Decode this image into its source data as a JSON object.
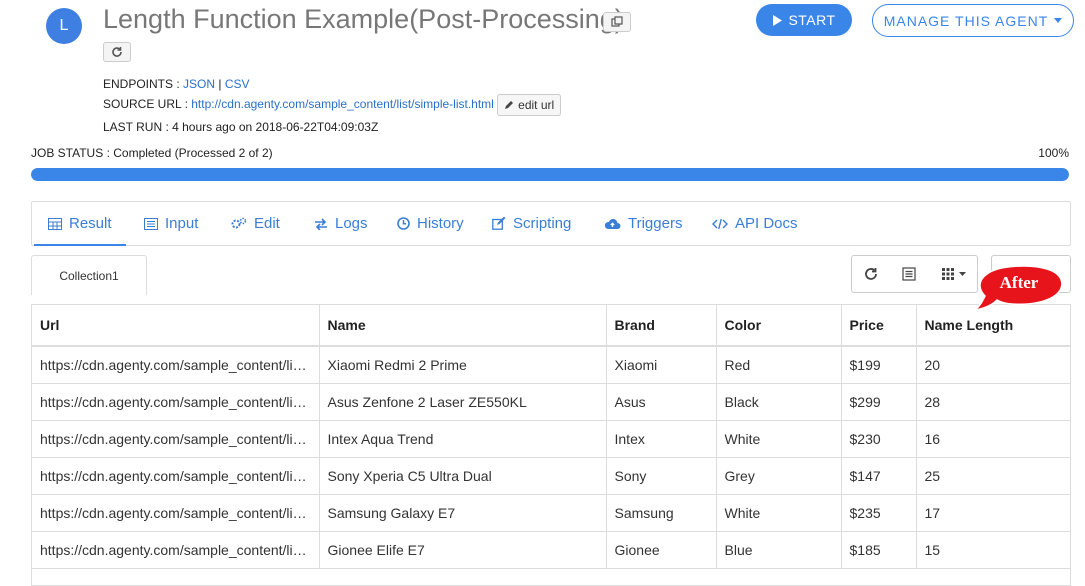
{
  "avatar": {
    "letter": "L"
  },
  "agent": {
    "title": "Length Function Example(Post-Processing)"
  },
  "endpoints": {
    "label": "ENDPOINTS :",
    "json": "JSON",
    "separator": "|",
    "csv": "CSV"
  },
  "source_url": {
    "label": "SOURCE URL :",
    "url": "http://cdn.agenty.com/sample_content/list/simple-list.html",
    "edit_label": "edit url"
  },
  "last_run": {
    "text": "LAST RUN : 4 hours ago on 2018-06-22T04:09:03Z"
  },
  "buttons": {
    "start": "START",
    "manage": "MANAGE THIS AGENT"
  },
  "job_status": {
    "text": "JOB STATUS : Completed (Processed 2 of 2)",
    "percent_label": "100%",
    "progress_percent": 100
  },
  "tabs": [
    {
      "label": "Result",
      "icon": "table-icon"
    },
    {
      "label": "Input",
      "icon": "list-icon"
    },
    {
      "label": "Edit",
      "icon": "cogs-icon"
    },
    {
      "label": "Logs",
      "icon": "exchange-icon"
    },
    {
      "label": "History",
      "icon": "clock-icon"
    },
    {
      "label": "Scripting",
      "icon": "edit-icon"
    },
    {
      "label": "Triggers",
      "icon": "cloud-upload-icon"
    },
    {
      "label": "API Docs",
      "icon": "code-icon"
    }
  ],
  "collection": {
    "tab": "Collection1"
  },
  "callout": {
    "text": "After",
    "color": "#e8141b"
  },
  "colors": {
    "accent": "#3a86e8",
    "link": "#2a70c9"
  },
  "table": {
    "columns": [
      "Url",
      "Name",
      "Brand",
      "Color",
      "Price",
      "Name Length"
    ],
    "rows": [
      [
        "https://cdn.agenty.com/sample_content/list/simple-list.html",
        "Xiaomi Redmi 2 Prime",
        "Xiaomi",
        "Red",
        "$199",
        "20"
      ],
      [
        "https://cdn.agenty.com/sample_content/list/simple-list.html",
        "Asus Zenfone 2 Laser ZE550KL",
        "Asus",
        "Black",
        "$299",
        "28"
      ],
      [
        "https://cdn.agenty.com/sample_content/list/simple-list.html",
        "Intex Aqua Trend",
        "Intex",
        "White",
        "$230",
        "16"
      ],
      [
        "https://cdn.agenty.com/sample_content/list/simple-list.html",
        "Sony Xperia C5 Ultra Dual",
        "Sony",
        "Grey",
        "$147",
        "25"
      ],
      [
        "https://cdn.agenty.com/sample_content/list/simple-list.html",
        "Samsung Galaxy E7",
        "Samsung",
        "White",
        "$235",
        "17"
      ],
      [
        "https://cdn.agenty.com/sample_content/list/simple-list.html",
        "Gionee Elife E7",
        "Gionee",
        "Blue",
        "$185",
        "15"
      ]
    ]
  }
}
